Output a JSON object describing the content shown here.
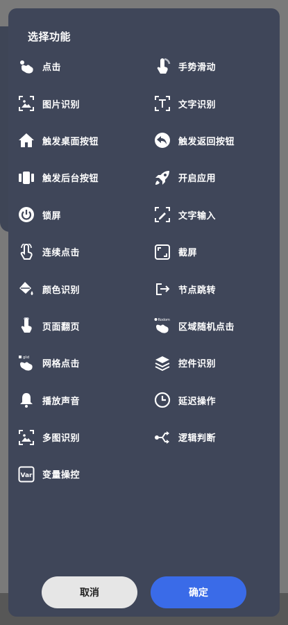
{
  "dialog": {
    "title": "选择功能",
    "cancel_label": "取消",
    "confirm_label": "确定"
  },
  "items": [
    {
      "label": "点击",
      "icon": "tap-icon"
    },
    {
      "label": "手势滑动",
      "icon": "swipe-icon"
    },
    {
      "label": "图片识别",
      "icon": "image-recognize-icon"
    },
    {
      "label": "文字识别",
      "icon": "text-recognize-icon"
    },
    {
      "label": "触发桌面按钮",
      "icon": "home-icon"
    },
    {
      "label": "触发返回按钮",
      "icon": "back-icon"
    },
    {
      "label": "触发后台按钮",
      "icon": "recents-icon"
    },
    {
      "label": "开启应用",
      "icon": "rocket-icon"
    },
    {
      "label": "锁屏",
      "icon": "power-icon"
    },
    {
      "label": "文字输入",
      "icon": "text-input-icon"
    },
    {
      "label": "连续点击",
      "icon": "multi-tap-icon"
    },
    {
      "label": "截屏",
      "icon": "screenshot-icon"
    },
    {
      "label": "颜色识别",
      "icon": "paint-bucket-icon"
    },
    {
      "label": "节点跳转",
      "icon": "node-jump-icon"
    },
    {
      "label": "页面翻页",
      "icon": "page-turn-icon"
    },
    {
      "label": "区域随机点击",
      "icon": "random-tap-icon",
      "badge": "Rodom"
    },
    {
      "label": "网格点击",
      "icon": "grid-tap-icon",
      "badge": "glid"
    },
    {
      "label": "控件识别",
      "icon": "layers-icon"
    },
    {
      "label": "播放声音",
      "icon": "bell-icon"
    },
    {
      "label": "延迟操作",
      "icon": "clock-icon"
    },
    {
      "label": "多图识别",
      "icon": "multi-image-icon"
    },
    {
      "label": "逻辑判断",
      "icon": "logic-branch-icon"
    },
    {
      "label": "变量操控",
      "icon": "variable-icon",
      "badge": "Var"
    }
  ],
  "colors": {
    "dialog_bg": "#3f4659",
    "confirm_bg": "#3a6be8",
    "cancel_bg": "#e6e6e6"
  }
}
